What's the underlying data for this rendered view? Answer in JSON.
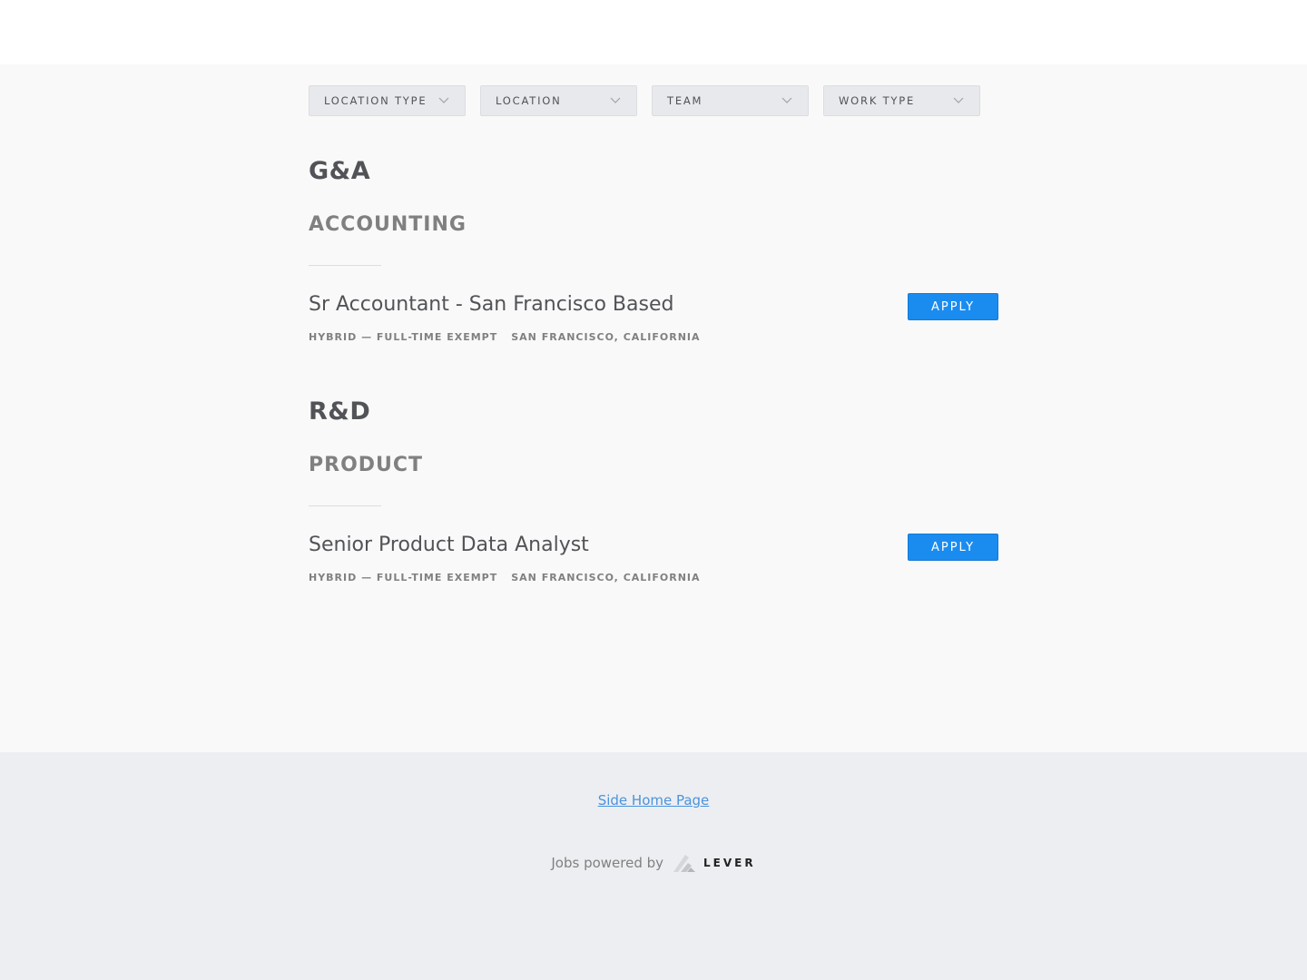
{
  "filters": [
    {
      "label": "LOCATION TYPE"
    },
    {
      "label": "LOCATION"
    },
    {
      "label": "TEAM"
    },
    {
      "label": "WORK TYPE"
    }
  ],
  "groups": [
    {
      "title": "G&A",
      "team": "ACCOUNTING",
      "posting": {
        "title": "Sr Accountant - San Francisco Based",
        "commitment": "HYBRID — FULL-TIME EXEMPT",
        "location": "SAN FRANCISCO, CALIFORNIA",
        "apply_label": "APPLY"
      }
    },
    {
      "title": "R&D",
      "team": "PRODUCT",
      "posting": {
        "title": "Senior Product Data Analyst",
        "commitment": "HYBRID — FULL-TIME EXEMPT",
        "location": "SAN FRANCISCO, CALIFORNIA",
        "apply_label": "APPLY"
      }
    }
  ],
  "footer": {
    "home_link": "Side Home Page",
    "powered_by": "Jobs powered by",
    "brand": "LEVER"
  },
  "colors": {
    "accent": "#1a8cf0",
    "link": "#4b93dc"
  }
}
